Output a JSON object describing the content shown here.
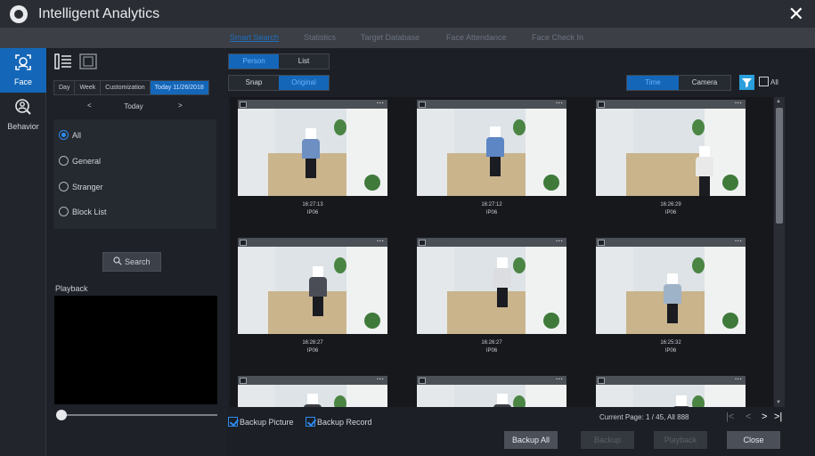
{
  "app": {
    "title": "Intelligent Analytics",
    "close_glyph": "✕",
    "logo_icon": "app-logo-icon"
  },
  "tabs": [
    {
      "label": "Smart Search",
      "active": true
    },
    {
      "label": "Statistics",
      "active": false
    },
    {
      "label": "Target Database",
      "active": false
    },
    {
      "label": "Face Attendance",
      "active": false
    },
    {
      "label": "Face Check In",
      "active": false
    }
  ],
  "leftnav": [
    {
      "label": "Face",
      "icon": "face-scan-icon",
      "active": true
    },
    {
      "label": "Behavior",
      "icon": "person-search-icon",
      "active": false
    }
  ],
  "view_icons": [
    "list-view-icon",
    "face-frame-view-icon"
  ],
  "date_tabs": [
    {
      "label": "Day",
      "active": false
    },
    {
      "label": "Week",
      "active": false
    },
    {
      "label": "Customization",
      "active": false
    },
    {
      "label": "Today 11/26/2018",
      "active": true
    }
  ],
  "date_nav": {
    "prev": "<",
    "label": "Today",
    "next": ">"
  },
  "filters": [
    {
      "label": "All",
      "checked": true
    },
    {
      "label": "General",
      "checked": false
    },
    {
      "label": "Stranger",
      "checked": false
    },
    {
      "label": "Block List",
      "checked": false
    }
  ],
  "search_button": "Search",
  "playback": {
    "label": "Playback",
    "progress": 0
  },
  "toolbar": {
    "view_mode": [
      {
        "label": "Person",
        "active": true
      },
      {
        "label": "List",
        "active": false
      }
    ],
    "image_mode": [
      {
        "label": "Snap",
        "active": false
      },
      {
        "label": "Original",
        "active": true
      }
    ],
    "sort_mode": [
      {
        "label": "Time",
        "active": true
      },
      {
        "label": "Camera",
        "active": false
      }
    ],
    "filter_icon": "funnel-icon",
    "all_label": "All",
    "all_checked": false
  },
  "results": [
    {
      "time": "16:27:13",
      "camera": "IP06"
    },
    {
      "time": "16:27:12",
      "camera": "IP06"
    },
    {
      "time": "16:26:29",
      "camera": "IP06"
    },
    {
      "time": "16:26:27",
      "camera": "IP06"
    },
    {
      "time": "16:26:27",
      "camera": "IP06"
    },
    {
      "time": "16:25:32",
      "camera": "IP06"
    },
    {
      "time": "",
      "camera": ""
    },
    {
      "time": "",
      "camera": ""
    },
    {
      "time": "",
      "camera": ""
    }
  ],
  "footer": {
    "backup_picture": {
      "label": "Backup Picture",
      "checked": true
    },
    "backup_record": {
      "label": "Backup Record",
      "checked": true
    },
    "page_info": "Current Page: 1 / 45, All 888",
    "pager": [
      "|<",
      "<",
      ">",
      ">|"
    ],
    "buttons": [
      {
        "label": "Backup All",
        "enabled": true
      },
      {
        "label": "Backup",
        "enabled": false
      },
      {
        "label": "Playback",
        "enabled": false
      },
      {
        "label": "Close",
        "enabled": true
      }
    ]
  },
  "colors": {
    "accent": "#1467b8",
    "filter": "#2a9fdc",
    "background": "#1c1f25"
  }
}
